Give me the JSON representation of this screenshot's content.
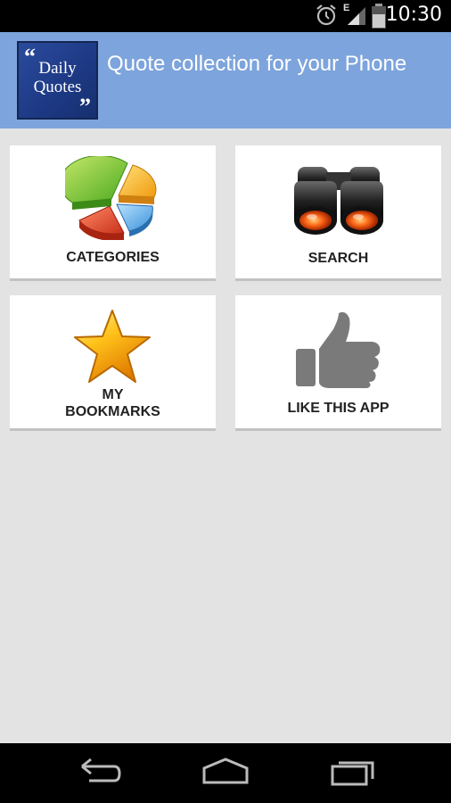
{
  "status_bar": {
    "time": "10:30",
    "network_label": "E",
    "icons": [
      "alarm-icon",
      "signal-icon",
      "battery-icon"
    ]
  },
  "header": {
    "logo": {
      "line1": "Daily",
      "line2": "Quotes",
      "open_quote": "“",
      "close_quote": "”"
    },
    "title": "Quote collection for your Phone"
  },
  "tiles": [
    {
      "label": "CATEGORIES",
      "icon": "pie-chart-icon"
    },
    {
      "label": "SEARCH",
      "icon": "binoculars-icon"
    },
    {
      "label_line1": "MY",
      "label_line2": "BOOKMARKS",
      "icon": "star-icon"
    },
    {
      "label": "LIKE THIS APP",
      "icon": "thumbs-up-icon"
    }
  ],
  "nav_bar": {
    "buttons": [
      "back-icon",
      "home-icon",
      "recent-apps-icon"
    ]
  },
  "colors": {
    "header_bg": "#7da4dc",
    "page_bg": "#e3e3e3",
    "tile_bg": "#ffffff"
  }
}
